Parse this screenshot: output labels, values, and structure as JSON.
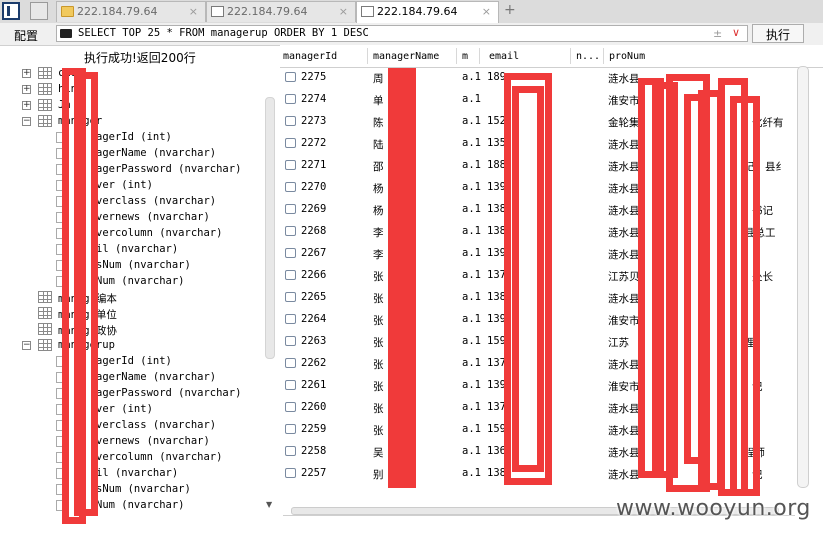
{
  "tabs": [
    {
      "label": "222.184.79.64",
      "icon": "folder-icon",
      "active": false
    },
    {
      "label": "222.184.79.64",
      "icon": "document-icon",
      "active": false
    },
    {
      "label": "222.184.79.64",
      "icon": "document-icon",
      "active": true
    }
  ],
  "tab_close_glyph": "×",
  "new_tab_glyph": "+",
  "toolbar": {
    "config_label": "配置",
    "sql_text": "SELECT TOP 25 * FROM managerup ORDER BY 1 DESC",
    "plusminus_glyph": "±",
    "dropdown_glyph": "∨",
    "execute_label": "执行"
  },
  "status_text": "执行成功!返回200行",
  "tree": [
    {
      "type": "table",
      "expander": "+",
      "label": "cno"
    },
    {
      "type": "table",
      "expander": "+",
      "label": "hin"
    },
    {
      "type": "table",
      "expander": "+",
      "label": "Ja"
    },
    {
      "type": "table",
      "expander": "−",
      "label": "manager"
    },
    {
      "type": "column",
      "label": "agerId (int)"
    },
    {
      "type": "column",
      "label": "agerName (nvarchar)"
    },
    {
      "type": "column",
      "label": "agerPassword (nvarchar)"
    },
    {
      "type": "column",
      "label": "ver (int)"
    },
    {
      "type": "column",
      "label": "verclass (nvarchar)"
    },
    {
      "type": "column",
      "label": "vernews (nvarchar)"
    },
    {
      "type": "column",
      "label": "vercolumn (nvarchar)"
    },
    {
      "type": "column",
      "label": "il (nvarchar)"
    },
    {
      "type": "column",
      "label": "sNum (nvarchar)"
    },
    {
      "type": "column",
      "label": "Num (nvarchar)"
    },
    {
      "type": "table",
      "expander": "",
      "label": "manag  编本"
    },
    {
      "type": "table",
      "expander": "",
      "label": "manag  单位"
    },
    {
      "type": "table",
      "expander": "",
      "label": "manag  政协"
    },
    {
      "type": "table",
      "expander": "−",
      "label": "managerup"
    },
    {
      "type": "column",
      "label": "agerId (int)"
    },
    {
      "type": "column",
      "label": "agerName (nvarchar)"
    },
    {
      "type": "column",
      "label": "agerPassword (nvarchar)"
    },
    {
      "type": "column",
      "label": "ver (int)"
    },
    {
      "type": "column",
      "label": "verclass (nvarchar)"
    },
    {
      "type": "column",
      "label": "vernews (nvarchar)"
    },
    {
      "type": "column",
      "label": "vercolumn (nvarchar)"
    },
    {
      "type": "column",
      "label": "il (nvarchar)"
    },
    {
      "type": "column",
      "label": "sNum (nvarchar)"
    },
    {
      "type": "column",
      "label": "Num (nvarchar)"
    }
  ],
  "grid": {
    "columns": [
      "managerId",
      "managerName",
      "m",
      "email",
      "n...",
      "proNum"
    ],
    "rows": [
      {
        "id": "2275",
        "name": "周",
        "m": "a.1",
        "email": "189",
        "pro": "涟水县"
      },
      {
        "id": "2274",
        "name": "单",
        "m": "a.1",
        "email": "",
        "pro": "淮安市"
      },
      {
        "id": "2273",
        "name": "陈",
        "m": "a.1",
        "email": "152",
        "pro": "金轮集"
      },
      {
        "id": "2272",
        "name": "陆",
        "m": "a.1",
        "email": "135",
        "pro": "涟水县"
      },
      {
        "id": "2271",
        "name": "邵",
        "m": "a.1",
        "email": "188",
        "pro": "涟水县"
      },
      {
        "id": "2270",
        "name": "杨",
        "m": "a.1",
        "email": "139",
        "pro": "涟水县"
      },
      {
        "id": "2269",
        "name": "杨",
        "m": "a.1",
        "email": "138",
        "pro": "涟水县"
      },
      {
        "id": "2268",
        "name": "李",
        "m": "a.1",
        "email": "138",
        "pro": "涟水县"
      },
      {
        "id": "2267",
        "name": "李",
        "m": "a.1",
        "email": "139",
        "pro": "涟水县"
      },
      {
        "id": "2266",
        "name": "张",
        "m": "a.1",
        "email": "137",
        "pro": "江苏贝"
      },
      {
        "id": "2265",
        "name": "张",
        "m": "a.1",
        "email": "138",
        "pro": "涟水县"
      },
      {
        "id": "2264",
        "name": "张",
        "m": "a.1",
        "email": "139",
        "pro": "淮安市"
      },
      {
        "id": "2263",
        "name": "张",
        "m": "a.1",
        "email": "159",
        "pro": "江苏"
      },
      {
        "id": "2262",
        "name": "张",
        "m": "a.1",
        "email": "137",
        "pro": "涟水县"
      },
      {
        "id": "2261",
        "name": "张",
        "m": "a.1",
        "email": "139",
        "pro": "淮安市"
      },
      {
        "id": "2260",
        "name": "张",
        "m": "a.1",
        "email": "137",
        "pro": "涟水县"
      },
      {
        "id": "2259",
        "name": "张",
        "m": "a.1",
        "email": "159",
        "pro": "涟水县"
      },
      {
        "id": "2258",
        "name": "吴",
        "m": "a.1",
        "email": "136",
        "pro": "涟水县"
      },
      {
        "id": "2257",
        "name": "别",
        "m": "a.1",
        "email": "138",
        "pro": "涟水县"
      }
    ],
    "right_fragments": [
      {
        "row": 2,
        "text": "化纤有"
      },
      {
        "row": 4,
        "text": "记，县纟"
      },
      {
        "row": 6,
        "text": "书记"
      },
      {
        "row": 7,
        "text": "县总工"
      },
      {
        "row": 9,
        "text": "处长"
      },
      {
        "row": 12,
        "text": "理"
      },
      {
        "row": 14,
        "text": "记"
      },
      {
        "row": 17,
        "text": "程师"
      },
      {
        "row": 18,
        "text": "记"
      }
    ]
  },
  "watermark": "www.wooyun.org",
  "colors": {
    "redaction": "#f03a3a",
    "tab_bar": "#dcdcdc"
  }
}
